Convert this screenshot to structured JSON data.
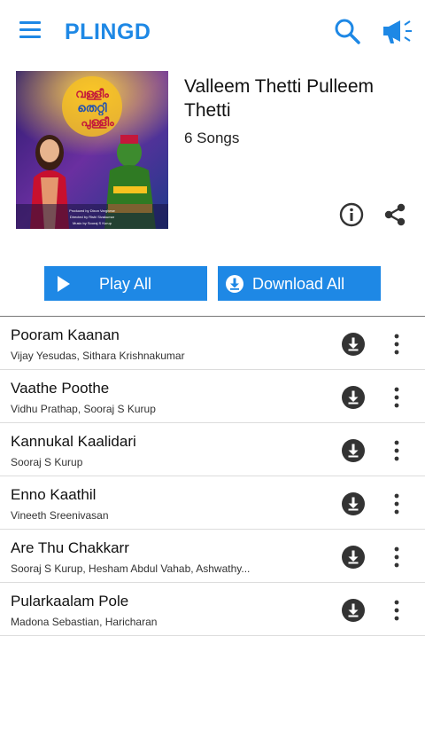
{
  "app": {
    "title": "PLINGD"
  },
  "album": {
    "title": "Valleem Thetti Pulleem Thetti",
    "song_count": "6 Songs",
    "cover_credits": [
      "Produced by Dixon Varghese",
      "Directed by Rishi Sivakumar",
      "Music by Sooraj S Kurup"
    ]
  },
  "actions": {
    "play_all": "Play All",
    "download_all": "Download All"
  },
  "songs": [
    {
      "title": "Pooram Kaanan",
      "artists": "Vijay Yesudas, Sithara Krishnakumar"
    },
    {
      "title": "Vaathe Poothe",
      "artists": "Vidhu Prathap, Sooraj S Kurup"
    },
    {
      "title": "Kannukal Kaalidari",
      "artists": "Sooraj S Kurup"
    },
    {
      "title": "Enno Kaathil",
      "artists": "Vineeth Sreenivasan"
    },
    {
      "title": "Are Thu Chakkarr",
      "artists": "Sooraj S Kurup, Hesham Abdul Vahab, Ashwathy..."
    },
    {
      "title": "Pularkaalam Pole",
      "artists": "Madona Sebastian, Haricharan"
    }
  ],
  "colors": {
    "accent": "#1e88e5",
    "icon_dark": "#333333"
  },
  "icons": [
    "menu-icon",
    "search-icon",
    "megaphone-icon",
    "info-icon",
    "share-icon",
    "play-icon",
    "download-icon",
    "more-vert-icon"
  ]
}
